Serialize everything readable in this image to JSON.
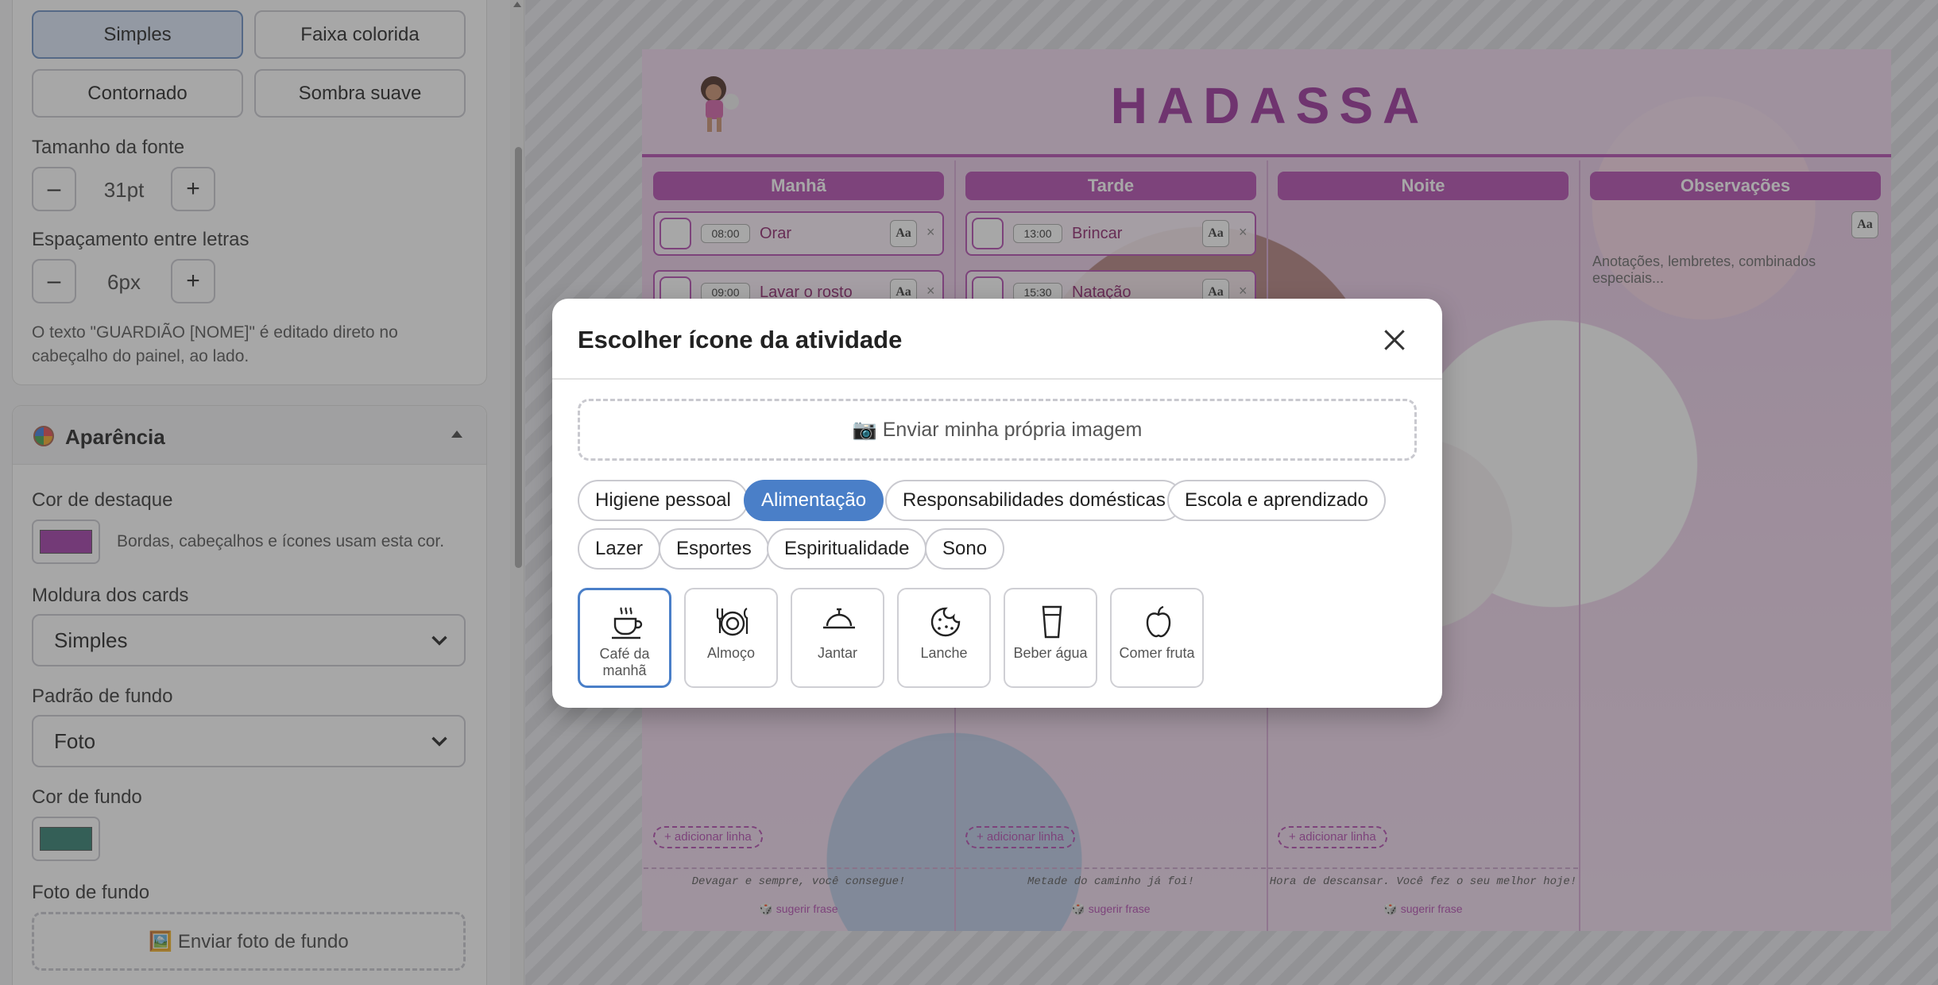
{
  "sidebar": {
    "frame_buttons": [
      "Simples",
      "Faixa colorida",
      "Contornado",
      "Sombra suave"
    ],
    "font_size": {
      "label": "Tamanho da fonte",
      "value": "31pt",
      "minus": "–",
      "plus": "+"
    },
    "letter_spacing": {
      "label": "Espaçamento entre letras",
      "value": "6px",
      "minus": "–",
      "plus": "+"
    },
    "hint": "O texto \"GUARDIÃO [NOME]\" é editado direto no cabeçalho do painel, ao lado.",
    "appearance": {
      "title": "Aparência",
      "accent_label": "Cor de destaque",
      "accent_color": "#a03aa8",
      "accent_hint": "Bordas, cabeçalhos e ícones usam esta cor.",
      "card_frame_label": "Moldura dos cards",
      "card_frame_value": "Simples",
      "bg_pattern_label": "Padrão de fundo",
      "bg_pattern_value": "Foto",
      "bg_color_label": "Cor de fundo",
      "bg_color": "#2e7d6e",
      "bg_photo_label": "Foto de fundo",
      "bg_photo_button": "🖼️ Enviar foto de fundo"
    }
  },
  "planner": {
    "title": "HADASSA",
    "accent": "#b24ab0",
    "columns": [
      {
        "title": "Manhã",
        "activities": [
          {
            "time": "08:00",
            "name": "Orar"
          },
          {
            "time": "09:00",
            "name": "Lavar o rosto"
          }
        ],
        "add": "+ adicionar linha",
        "quote": "Devagar e sempre, você consegue!",
        "suggest": "🎲 sugerir frase"
      },
      {
        "title": "Tarde",
        "activities": [
          {
            "time": "13:00",
            "name": "Brincar"
          },
          {
            "time": "15:30",
            "name": "Natação"
          }
        ],
        "add": "+ adicionar linha",
        "quote": "Metade do caminho já foi!",
        "suggest": "🎲 sugerir frase"
      },
      {
        "title": "Noite",
        "activities": [],
        "add": "+ adicionar linha",
        "quote": "Hora de descansar. Você fez o seu melhor hoje!",
        "suggest": "🎲 sugerir frase"
      },
      {
        "title": "Observações",
        "note": "Anotações, lembretes, combinados especiais..."
      }
    ],
    "aa": "Aa",
    "remove": "×"
  },
  "modal": {
    "title": "Escolher ícone da atividade",
    "upload": "📷 Enviar minha própria imagem",
    "categories": [
      "Higiene pessoal",
      "Alimentação",
      "Responsabilidades domésticas",
      "Escola e aprendizado",
      "Lazer",
      "Esportes",
      "Espiritualidade",
      "Sono"
    ],
    "active_category": "Alimentação",
    "icons": [
      {
        "label": "Café da manhã",
        "icon": "coffee-cup-icon"
      },
      {
        "label": "Almoço",
        "icon": "plate-cutlery-icon"
      },
      {
        "label": "Jantar",
        "icon": "cloche-icon"
      },
      {
        "label": "Lanche",
        "icon": "cookie-icon"
      },
      {
        "label": "Beber água",
        "icon": "glass-icon"
      },
      {
        "label": "Comer fruta",
        "icon": "apple-icon"
      }
    ],
    "selected_icon": "Café da manhã"
  }
}
